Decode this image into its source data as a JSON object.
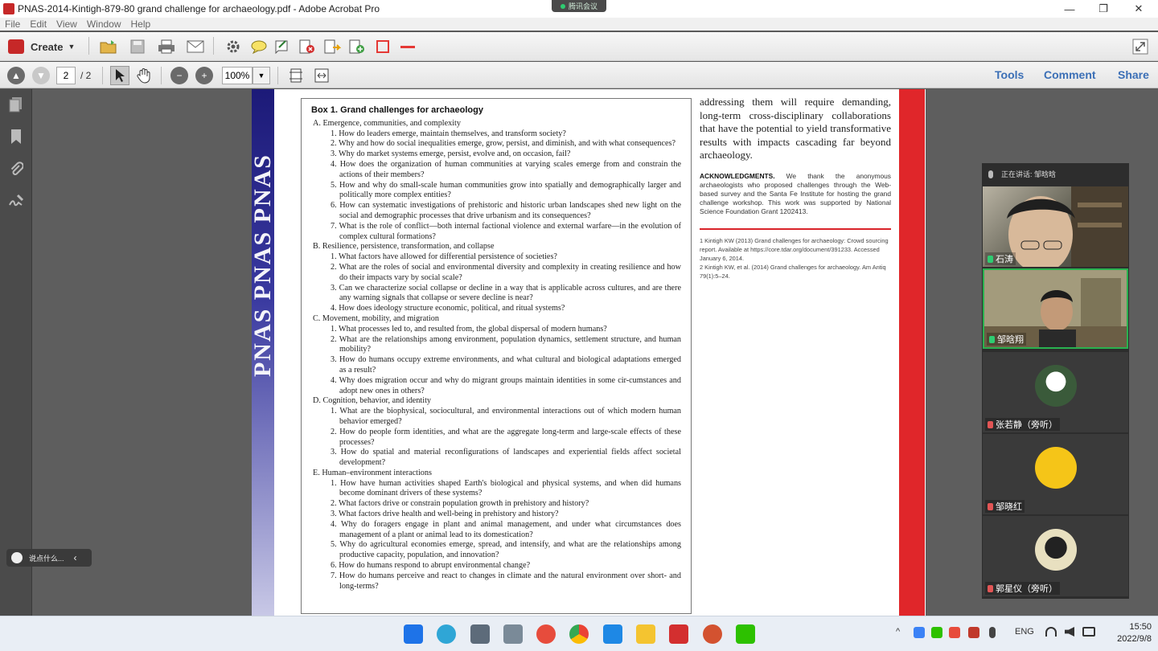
{
  "window": {
    "title": "PNAS-2014-Kintigh-879-80 grand challenge for archaeology.pdf - Adobe Acrobat Pro",
    "meeting_pill": "腾讯会议",
    "minimize": "—",
    "restore": "❐",
    "close": "✕"
  },
  "menu": [
    "File",
    "Edit",
    "View",
    "Window",
    "Help"
  ],
  "toolbar": {
    "create_label": "Create"
  },
  "nav": {
    "page_current": "2",
    "page_total": "/ 2",
    "zoom": "100%",
    "tools": "Tools",
    "comment": "Comment",
    "share": "Share"
  },
  "doc": {
    "pnas": "PNAS PNAS PNAS",
    "box_title": "Box 1. Grand challenges for archaeology",
    "sections": [
      {
        "heading": "A. Emergence, communities, and complexity",
        "items": [
          "1. How do leaders emerge, maintain themselves, and transform society?",
          "2. Why and how do social inequalities emerge, grow, persist, and diminish, and with what consequences?",
          "3. Why do market systems emerge, persist, evolve and, on occasion, fail?",
          "4. How does the organization of human communities at varying scales emerge from and constrain the actions of their members?",
          "5. How and why do small-scale human communities grow into spatially and demographically larger and politically more complex entities?",
          "6. How can systematic investigations of prehistoric and historic urban landscapes shed new light on the social and demographic processes that drive urbanism and its consequences?",
          "7. What is the role of conflict—both internal factional violence and external warfare—in the evolution of complex cultural formations?"
        ]
      },
      {
        "heading": "B. Resilience, persistence, transformation, and collapse",
        "items": [
          "1. What factors have allowed for differential persistence of societies?",
          "2. What are the roles of social and environmental diversity and complexity in creating resilience and how do their impacts vary by social scale?",
          "3. Can we characterize social collapse or decline in a way that is applicable across cultures, and are there any warning signals that collapse or severe decline is near?",
          "4. How does ideology structure economic, political, and ritual systems?"
        ]
      },
      {
        "heading": "C. Movement, mobility, and migration",
        "items": [
          "1. What processes led to, and resulted from, the global dispersal of modern humans?",
          "2. What are the relationships among environment, population dynamics, settlement structure, and human mobility?",
          "3. How do humans occupy extreme environments, and what cultural and biological adaptations emerged as a result?",
          "4. Why does migration occur and why do migrant groups maintain identities in some cir-cumstances and adopt new ones in others?"
        ]
      },
      {
        "heading": "D. Cognition, behavior, and identity",
        "items": [
          "1. What are the biophysical, sociocultural, and environmental interactions out of which modern human behavior emerged?",
          "2. How do people form identities, and what are the aggregate long-term and large-scale effects of these processes?",
          "3. How do spatial and material reconfigurations of landscapes and experiential fields affect societal development?"
        ]
      },
      {
        "heading": "E. Human–environment interactions",
        "items": [
          "1. How have human activities shaped Earth's biological and physical systems, and when did humans become dominant drivers of these systems?",
          "2. What factors drive or constrain population growth in prehistory and history?",
          "3. What factors drive health and well-being in prehistory and history?",
          "4. Why do foragers engage in plant and animal management, and under what circumstances does management of a plant or animal lead to its domestication?",
          "5. Why do agricultural economies emerge, spread, and intensify, and what are the relationships among productive capacity, population, and innovation?",
          "6. How do humans respond to abrupt environmental change?",
          "7. How do humans perceive and react to changes in climate and the natural environment over short- and long-terms?"
        ]
      }
    ],
    "right_para": "addressing them will require demanding, long-term cross-disciplinary collaborations that have the potential to yield transformative results with impacts cascading far beyond archaeology.",
    "ack_label": "ACKNOWLEDGMENTS.",
    "ack_text": " We thank the anonymous archaeologists who proposed challenges through the Web-based survey and the Santa Fe Institute for hosting the grand challenge workshop. This work was supported by National Science Foundation Grant 1202413.",
    "ref1": "1  Kintigh KW (2013) Grand challenges for archaeology: Crowd sourcing report. Available at https://core.tdar.org/document/391233. Accessed January 6, 2014.",
    "ref2": "2  Kintigh KW, et al. (2014) Grand challenges for archaeology. Am Antiq 79(1):5–24."
  },
  "meeting": {
    "speaking": "正在讲话: 邹晗晗",
    "participants": [
      "石涛",
      "邹晗翔",
      "张若静（旁听）",
      "邹晓红",
      "郭星仪（旁听）"
    ]
  },
  "float_pill": {
    "label": "说点什么..."
  },
  "taskbar": {
    "lang": "ENG",
    "time": "15:50",
    "date": "2022/9/8"
  },
  "colors": {
    "pnas_blue": "#1c1a78",
    "pnas_red": "#e0262a",
    "link_blue": "#3b6fb6",
    "speaking_green": "#29b14f"
  }
}
